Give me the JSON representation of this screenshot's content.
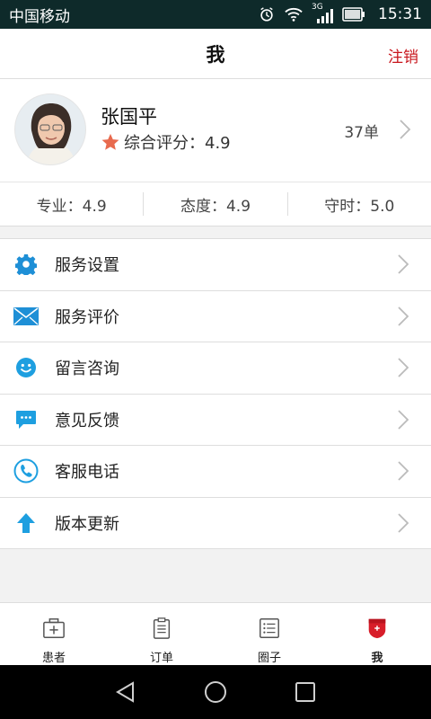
{
  "status_bar": {
    "carrier": "中国移动",
    "network": "3G",
    "time": "15:31"
  },
  "header": {
    "title": "我",
    "logout_label": "注销"
  },
  "profile": {
    "name": "张国平",
    "rating_label": "综合评分：4.9",
    "order_count": "37单"
  },
  "scores": [
    {
      "label": "专业：4.9"
    },
    {
      "label": "态度：4.9"
    },
    {
      "label": "守时：5.0"
    }
  ],
  "menu": [
    {
      "label": "服务设置",
      "icon": "gear-icon"
    },
    {
      "label": "服务评价",
      "icon": "mail-icon"
    },
    {
      "label": "留言咨询",
      "icon": "smiley-icon"
    },
    {
      "label": "意见反馈",
      "icon": "chat-bubble-icon"
    },
    {
      "label": "客服电话",
      "icon": "phone-icon"
    },
    {
      "label": "版本更新",
      "icon": "arrow-up-icon"
    }
  ],
  "tabs": [
    {
      "label": "患者",
      "icon": "medical-kit-icon"
    },
    {
      "label": "订单",
      "icon": "clipboard-icon"
    },
    {
      "label": "圈子",
      "icon": "list-icon"
    },
    {
      "label": "我",
      "icon": "badge-icon",
      "active": true
    }
  ],
  "colors": {
    "accent_red": "#c8161d",
    "icon_blue": "#1e8fd6",
    "star": "#e86a4e"
  }
}
